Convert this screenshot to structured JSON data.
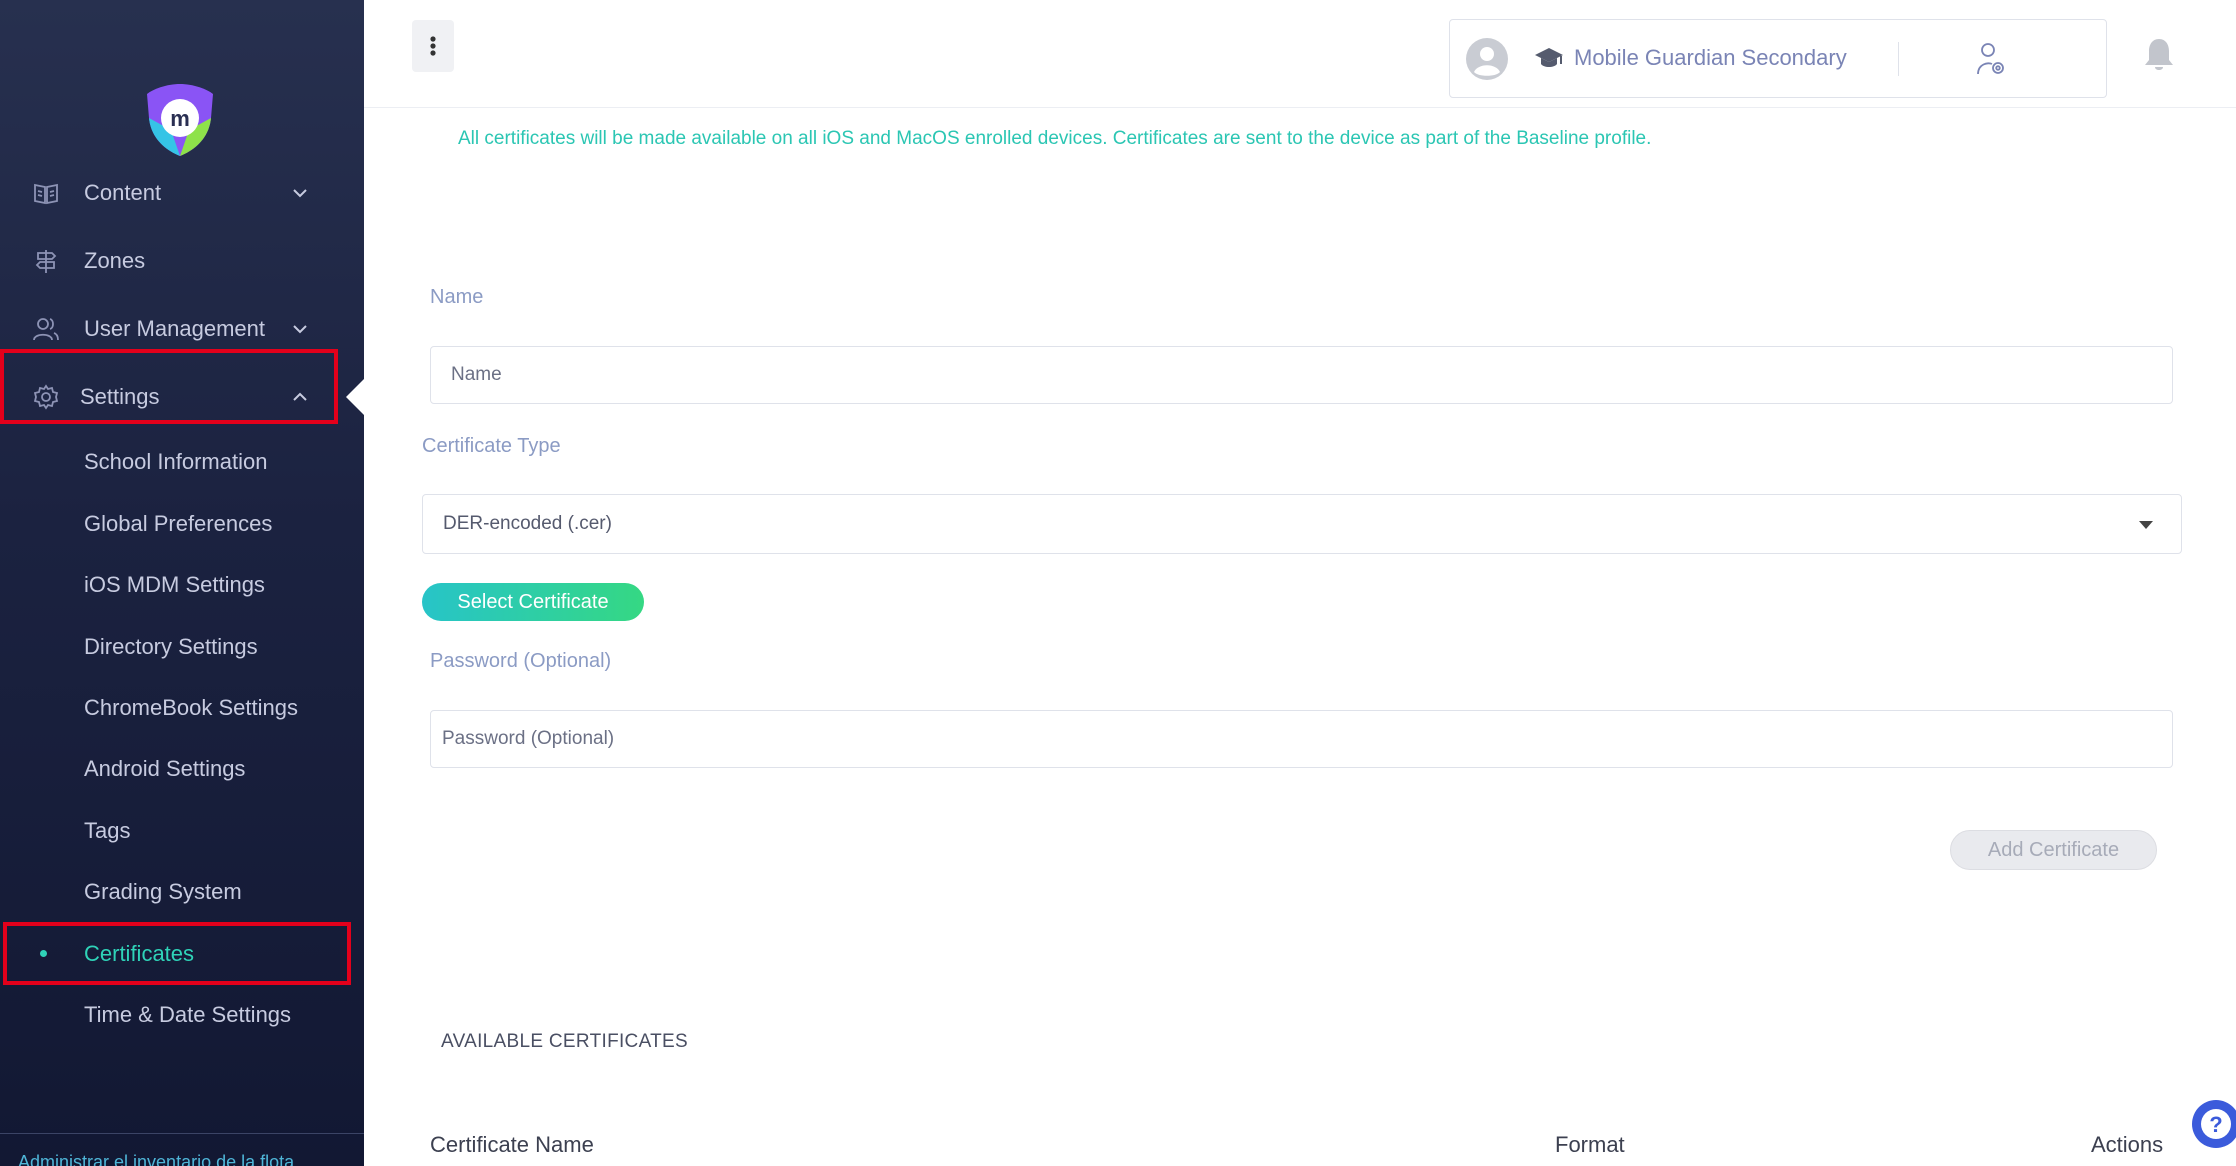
{
  "sidebar": {
    "nav": [
      {
        "label": "Content",
        "icon": "book-icon",
        "expandable": true
      },
      {
        "label": "Zones",
        "icon": "signpost-icon",
        "expandable": false
      },
      {
        "label": "User Management",
        "icon": "users-icon",
        "expandable": true
      },
      {
        "label": "Settings",
        "icon": "gear-icon",
        "expandable": true,
        "expanded": true
      }
    ],
    "settings_items": [
      {
        "label": "School Information"
      },
      {
        "label": "Global Preferences"
      },
      {
        "label": "iOS MDM Settings"
      },
      {
        "label": "Directory Settings"
      },
      {
        "label": "ChromeBook Settings"
      },
      {
        "label": "Android Settings"
      },
      {
        "label": "Tags"
      },
      {
        "label": "Grading System"
      },
      {
        "label": "Certificates",
        "active": true
      },
      {
        "label": "Time & Date Settings"
      }
    ],
    "footer_text": "Administrar el inventario de la flota"
  },
  "header": {
    "school_name": "Mobile Guardian Secondary"
  },
  "main": {
    "info_text": "All certificates will be made available on all iOS and MacOS enrolled devices. Certificates are sent to the device as part of the Baseline profile.",
    "name_label": "Name",
    "name_placeholder": "Name",
    "type_label": "Certificate Type",
    "type_value": "DER-encoded (.cer)",
    "select_button": "Select Certificate",
    "password_label": "Password (Optional)",
    "password_placeholder": "Password (Optional)",
    "add_button": "Add Certificate",
    "section_title": "AVAILABLE CERTIFICATES",
    "table_headers": [
      "Certificate Name",
      "Format",
      "Actions"
    ]
  },
  "colors": {
    "accent": "#2fd3b8",
    "highlight": "#e3001b",
    "sidebar_bg": "#1b2240"
  }
}
